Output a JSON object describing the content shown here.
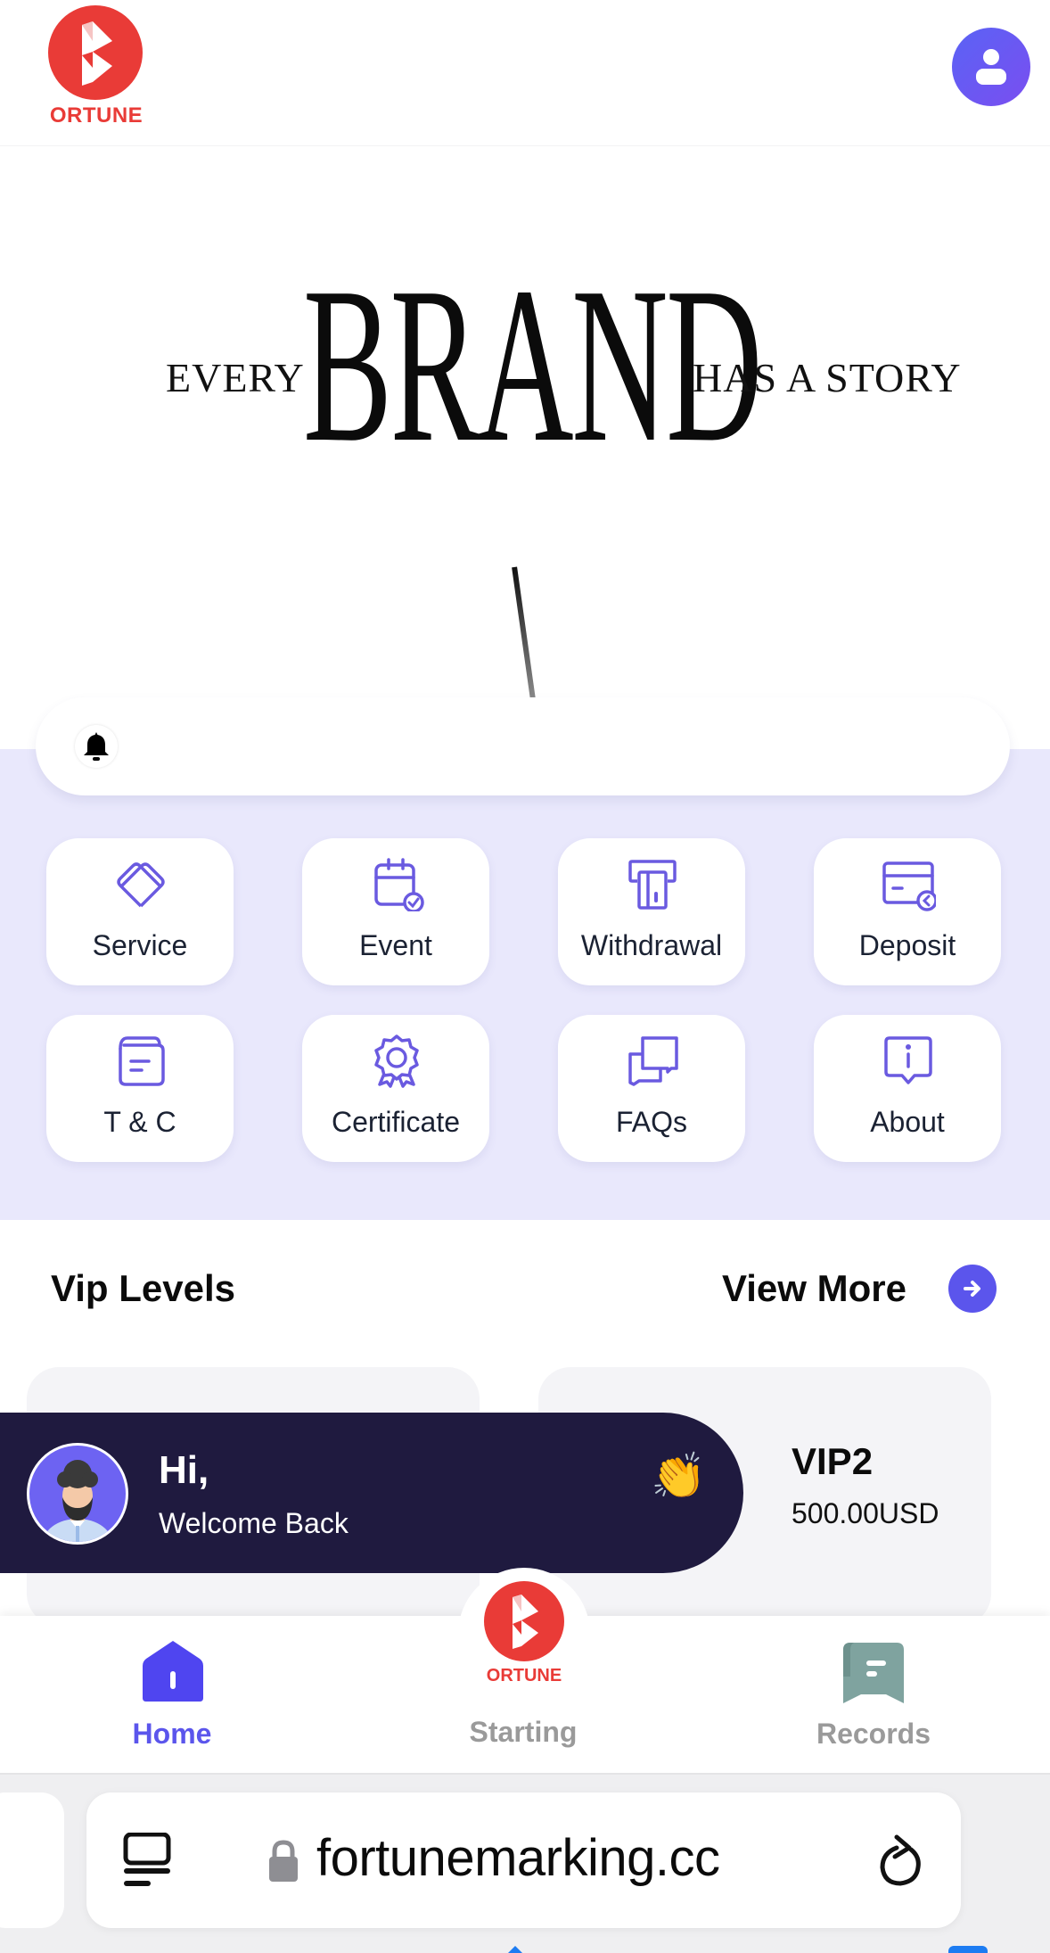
{
  "header": {
    "logo_text": "ORTUNE",
    "profile_icon": "user-icon"
  },
  "banner": {
    "word_left": "EVERY",
    "word_main": "BRAND",
    "word_right": "HAS A STORY"
  },
  "notice": {
    "icon": "bell-icon",
    "text": ""
  },
  "menu": {
    "items": [
      {
        "label": "Service",
        "icon": "service-icon"
      },
      {
        "label": "Event",
        "icon": "calendar-check-icon"
      },
      {
        "label": "Withdrawal",
        "icon": "atm-card-icon"
      },
      {
        "label": "Deposit",
        "icon": "card-deposit-icon"
      },
      {
        "label": "T & C",
        "icon": "document-icon"
      },
      {
        "label": "Certificate",
        "icon": "badge-icon"
      },
      {
        "label": "FAQs",
        "icon": "chat-bubbles-icon"
      },
      {
        "label": "About",
        "icon": "info-bubble-icon"
      }
    ]
  },
  "vip": {
    "title": "Vip Levels",
    "view_more": "View More",
    "cards": [
      {
        "name": "",
        "price": ""
      },
      {
        "name": "VIP2",
        "price": "500.00USD"
      }
    ]
  },
  "welcome": {
    "greeting": "Hi,",
    "message": "Welcome Back",
    "emoji": "👏"
  },
  "bottom_nav": {
    "items": [
      {
        "label": "Home",
        "icon": "home-icon",
        "active": true
      },
      {
        "label": "Starting",
        "icon": "fortune-logo-icon",
        "active": false
      },
      {
        "label": "Records",
        "icon": "records-icon",
        "active": false
      }
    ],
    "center_logo_text": "ORTUNE"
  },
  "browser": {
    "url": "fortunemarking.cc"
  },
  "colors": {
    "brand_red": "#e93b37",
    "accent_purple": "#5b55ec",
    "section_bg": "#e9e8fc",
    "toast_bg": "#1f1a3f",
    "records_teal": "#7fa39f"
  }
}
